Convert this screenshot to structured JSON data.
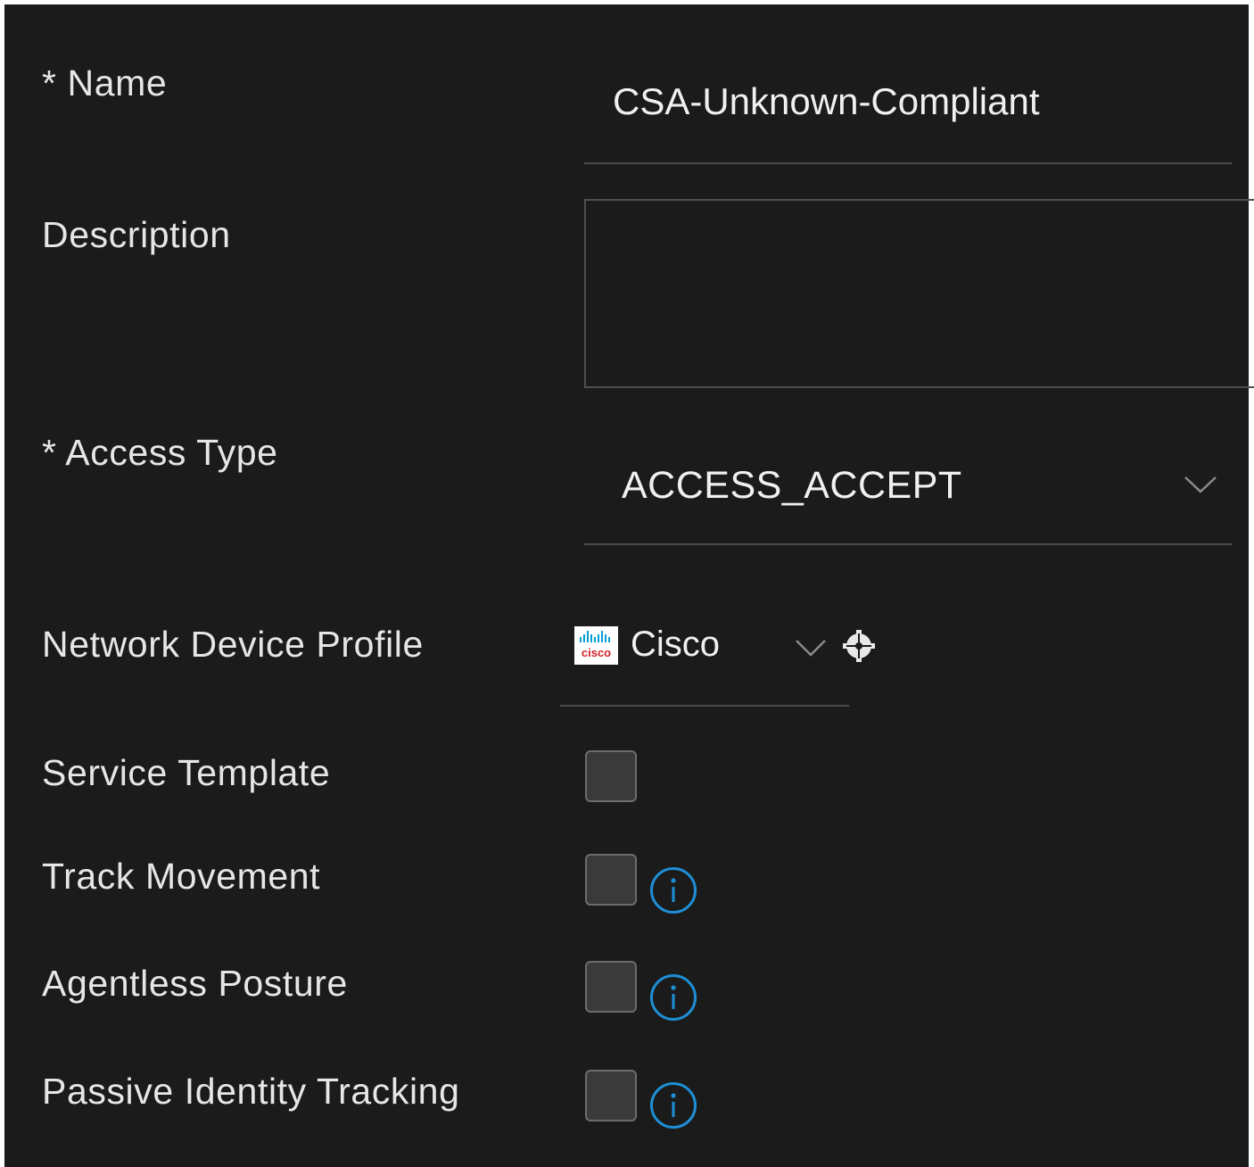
{
  "fields": {
    "name": {
      "label": "* Name",
      "value": "CSA-Unknown-Compliant"
    },
    "description": {
      "label": "Description",
      "value": ""
    },
    "access_type": {
      "label": "* Access Type",
      "value": "ACCESS_ACCEPT"
    },
    "network_device_profile": {
      "label": "Network Device Profile",
      "value": "Cisco",
      "logo_text": "cisco"
    },
    "service_template": {
      "label": "Service Template",
      "checked": false
    },
    "track_movement": {
      "label": "Track Movement",
      "checked": false
    },
    "agentless_posture": {
      "label": "Agentless Posture",
      "checked": false
    },
    "passive_identity_tracking": {
      "label": "Passive Identity Tracking",
      "checked": false
    }
  },
  "icons": {
    "dropdown": "chevron-down-icon",
    "profile_settings": "gear-icon",
    "info": "info-icon",
    "brand": "cisco-logo"
  },
  "colors": {
    "background": "#1b1b1b",
    "text": "#e6e6e6",
    "info_accent": "#1e8fd6",
    "brand_red": "#d0242b",
    "brand_blue": "#049fd9"
  }
}
